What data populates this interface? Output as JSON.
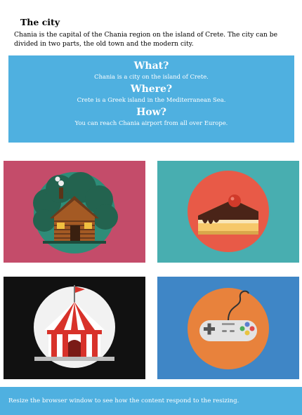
{
  "page": {
    "title": "The city",
    "intro": "Chania is the capital of the Chania region on the island of Crete. The city can be divided in two parts, the old town and the modern city."
  },
  "info": {
    "what_heading": "What?",
    "what_text": "Chania is a city on the island of Crete.",
    "where_heading": "Where?",
    "where_text": "Crete is a Greek island in the Mediterranean Sea.",
    "how_heading": "How?",
    "how_text": "You can reach Chania airport from all over Europe.",
    "background": "#4fb0e0"
  },
  "tiles": [
    {
      "icon": "log-cabin-icon",
      "background": "#c44c6a"
    },
    {
      "icon": "cake-slice-icon",
      "background": "#48aeb0"
    },
    {
      "icon": "circus-tent-icon",
      "background": "#111111"
    },
    {
      "icon": "gamepad-icon",
      "background": "#3f86c6"
    }
  ],
  "footer": {
    "text": "Resize the browser window to see how the content respond to the resizing."
  }
}
